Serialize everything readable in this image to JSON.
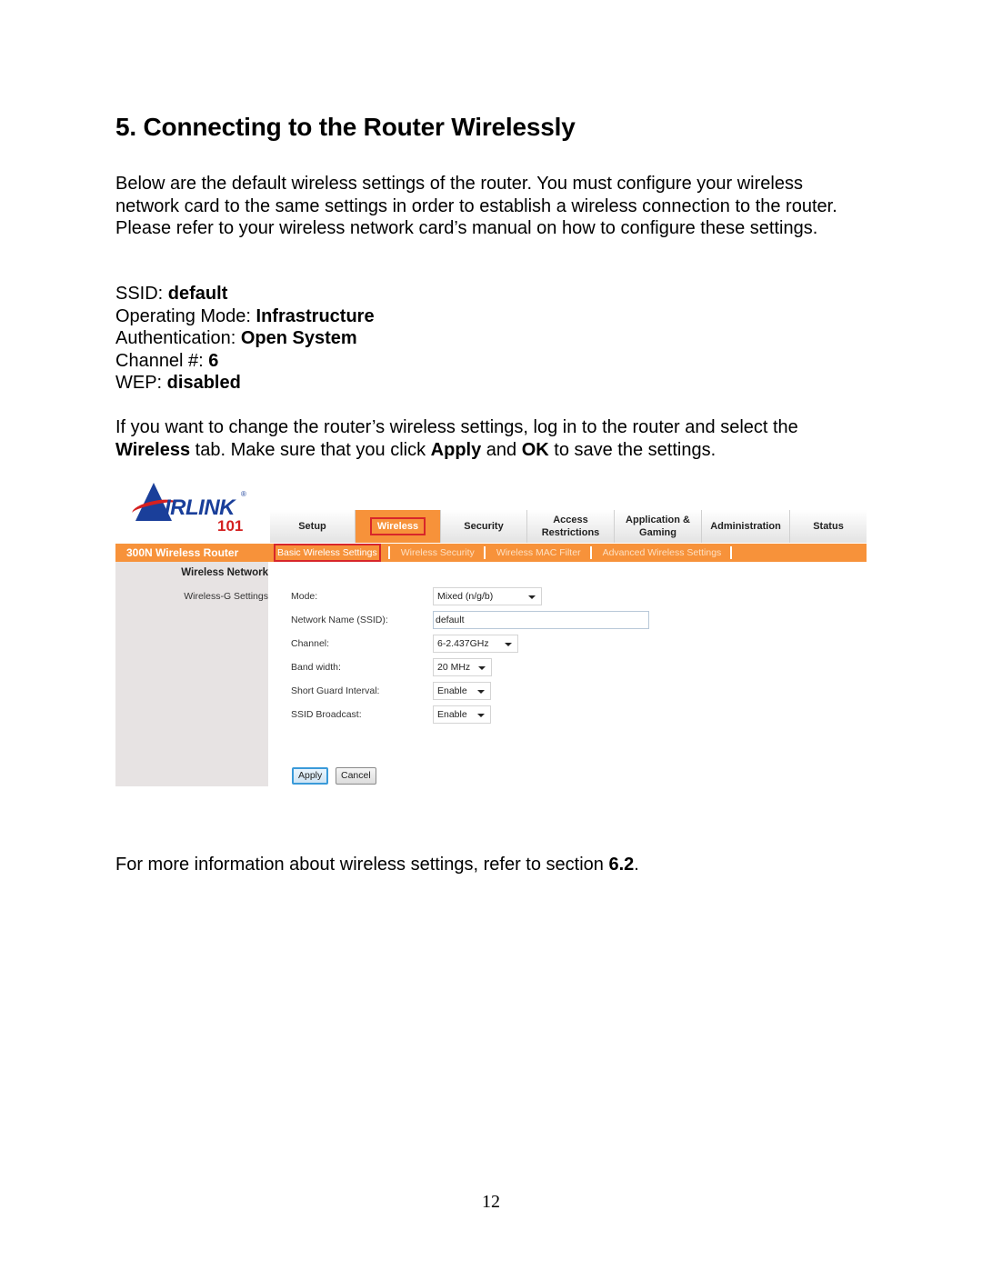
{
  "heading": "5. Connecting to the Router Wirelessly",
  "intro": "Below are the default wireless settings of the router. You must configure your wireless network card to the same settings in order to establish a wireless connection to the router. Please refer to your wireless network card’s manual on how to configure these settings.",
  "defaults": [
    {
      "label": "SSID: ",
      "value": "default"
    },
    {
      "label": "Operating Mode: ",
      "value": "Infrastructure"
    },
    {
      "label": "Authentication: ",
      "value": "Open System"
    },
    {
      "label": "Channel #: ",
      "value": "6"
    },
    {
      "label": "WEP: ",
      "value": "disabled"
    }
  ],
  "instructions": {
    "t1": "If you want to change the router’s wireless settings, log in to the router and select the ",
    "b1": "Wireless",
    "t2": " tab.  Make sure that you click ",
    "b2": "Apply",
    "t3": " and ",
    "b3": "OK",
    "t4": " to save the settings."
  },
  "router_ui": {
    "logo": {
      "brand": "IRLINK",
      "registered": "®",
      "number": "101"
    },
    "tabs": [
      {
        "label": "Setup",
        "active": false
      },
      {
        "label": "Wireless",
        "active": true
      },
      {
        "label": "Security",
        "active": false
      },
      {
        "label": "Access Restrictions",
        "active": false
      },
      {
        "label": "Application & Gaming",
        "active": false
      },
      {
        "label": "Administration",
        "active": false
      },
      {
        "label": "Status",
        "active": false
      }
    ],
    "product_name": "300N Wireless Router",
    "subtabs": [
      {
        "label": "Basic Wireless Settings",
        "active": true
      },
      {
        "label": "Wireless Security",
        "active": false
      },
      {
        "label": "Wireless MAC Filter",
        "active": false
      },
      {
        "label": "Advanced Wireless Settings",
        "active": false
      }
    ],
    "sidebar": {
      "heading": "Wireless Network",
      "item": "Wireless-G Settings"
    },
    "fields": {
      "mode": {
        "label": "Mode:",
        "value": "Mixed (n/g/b)"
      },
      "ssid": {
        "label": "Network Name (SSID):",
        "value": "default"
      },
      "channel": {
        "label": "Channel:",
        "value": "6-2.437GHz"
      },
      "bandwidth": {
        "label": "Band width:",
        "value": "20 MHz"
      },
      "guard": {
        "label": "Short Guard Interval:",
        "value": "Enable"
      },
      "broadcast": {
        "label": "SSID Broadcast:",
        "value": "Enable"
      }
    },
    "buttons": {
      "apply": "Apply",
      "cancel": "Cancel"
    },
    "colors": {
      "accent_orange": "#f7923a",
      "highlight_red": "#d8262a",
      "logo_blue": "#1a3f9a"
    }
  },
  "footer_note": {
    "text": "For more information about wireless settings, refer to section ",
    "section": "6.2",
    "end": "."
  },
  "page_number": "12"
}
